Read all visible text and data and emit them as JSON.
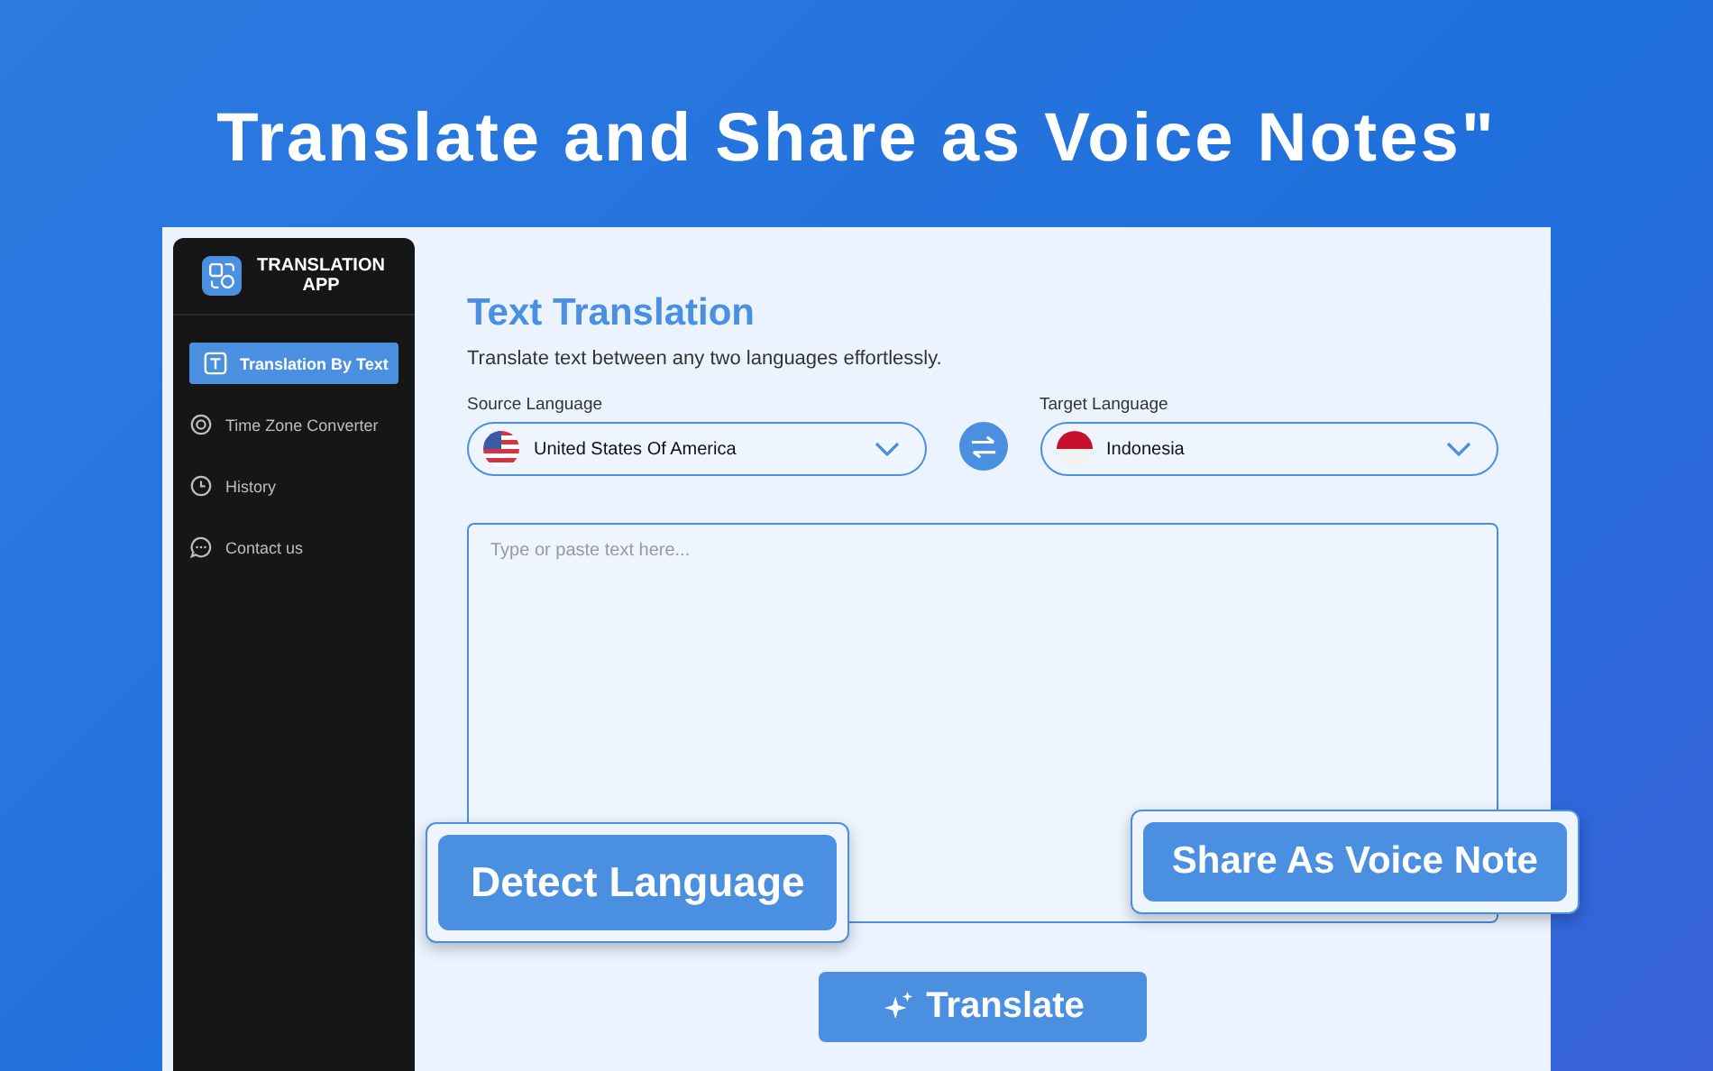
{
  "headline": "Translate and Share as Voice Notes\"",
  "app": {
    "title": "TRANSLATION APP"
  },
  "sidebar": {
    "items": [
      {
        "label": "Translation By Text",
        "selected": true
      },
      {
        "label": "Time Zone Converter",
        "selected": false
      },
      {
        "label": "History",
        "selected": false
      },
      {
        "label": "Contact us",
        "selected": false
      }
    ]
  },
  "main": {
    "title": "Text Translation",
    "subtitle": "Translate text between any two languages effortlessly.",
    "source": {
      "label": "Source Language",
      "value": "United States Of America"
    },
    "target": {
      "label": "Target Language",
      "value": "Indonesia"
    },
    "input": {
      "placeholder": "Type or paste text here..."
    },
    "translate_button": "Translate"
  },
  "callouts": {
    "left": "Detect Language",
    "right": "Share As Voice Note"
  }
}
